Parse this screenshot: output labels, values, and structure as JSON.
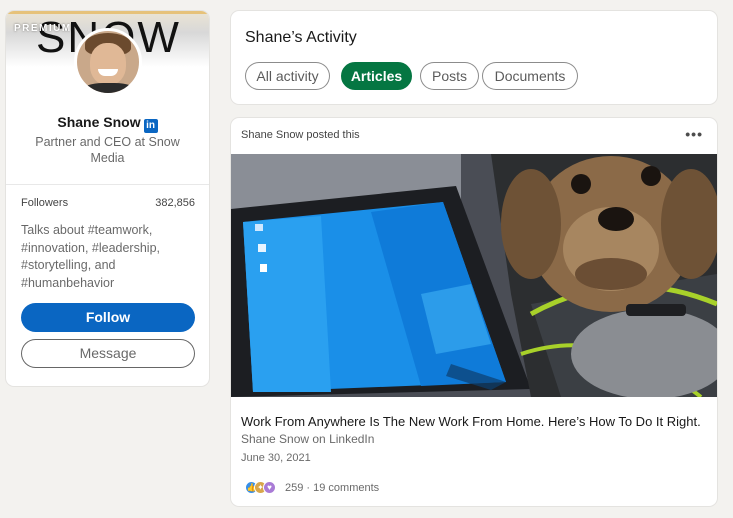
{
  "profile": {
    "banner_text": "SNOW",
    "premium_label": "PREMIUM",
    "name": "Shane Snow",
    "linkedin_badge": "in",
    "headline": "Partner and CEO at Snow Media",
    "followers_label": "Followers",
    "followers_count": "382,856",
    "talks_about": "Talks about #teamwork, #innovation, #leadership, #storytelling, and #humanbehavior",
    "follow_label": "Follow",
    "message_label": "Message"
  },
  "activity": {
    "title": "Shane’s Activity",
    "tabs": [
      {
        "label": "All activity",
        "active": false
      },
      {
        "label": "Articles",
        "active": true
      },
      {
        "label": "Posts",
        "active": false
      },
      {
        "label": "Documents",
        "active": false
      }
    ]
  },
  "post": {
    "posted_by": "Shane Snow posted this",
    "more_icon": "more-horizontal-icon",
    "article_title": "Work From Anywhere Is The New Work From Home. Here’s How To Do It Right.",
    "article_source": "Shane Snow on LinkedIn",
    "date": "June 30, 2021",
    "reaction_icons": [
      "like-icon",
      "celebrate-icon",
      "love-icon"
    ],
    "reactions_text": "259 · 19 comments"
  },
  "colors": {
    "linkedin_blue": "#0a66c2",
    "active_tab_green": "#057642",
    "background": "#f3f2ef"
  }
}
